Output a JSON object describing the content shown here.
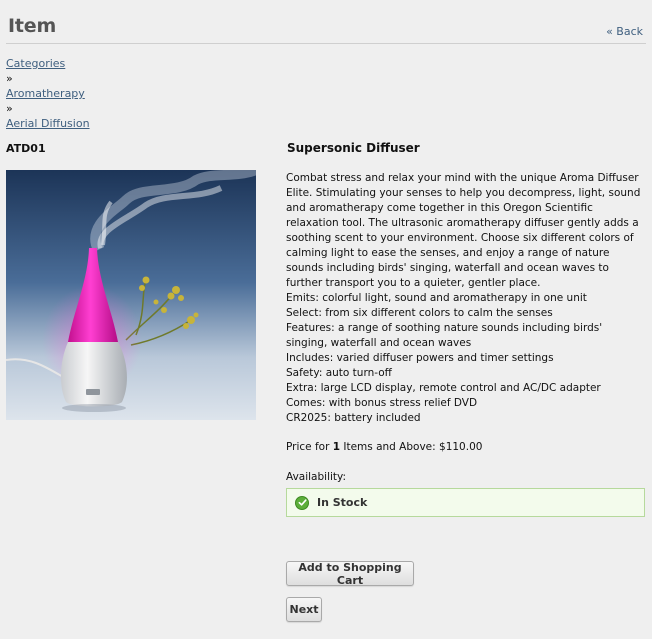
{
  "header": {
    "title": "Item",
    "back_label": "« Back"
  },
  "breadcrumb": {
    "items": [
      "Categories",
      "Aromatherapy",
      "Aerial Diffusion"
    ],
    "separator": "»"
  },
  "product": {
    "sku": "ATD01",
    "name": "Supersonic Diffuser",
    "image": "aroma-diffuser-photo",
    "description": [
      "Combat stress and relax your mind with the unique Aroma Diffuser Elite. Stimulating your senses to help you decompress, light, sound and aromatherapy come together in this Oregon Scientific relaxation tool. The ultrasonic aromatherapy diffuser gently adds a soothing scent to your environment. Choose six different colors of calming light to ease the senses, and enjoy a range of nature sounds including birds' singing, waterfall and ocean waves to further transport you to a quieter, gentler place.",
      "Emits: colorful light, sound and aromatherapy in one unit",
      "Select: from six different colors to calm the senses",
      "Features: a range of soothing nature sounds including birds' singing, waterfall and ocean waves",
      "Includes: varied diffuser powers and timer settings",
      "Safety: auto turn-off",
      "Extra: large LCD display, remote control and AC/DC adapter",
      "Comes: with bonus stress relief DVD",
      "CR2025: battery included"
    ],
    "price": {
      "prefix": "Price for ",
      "qty": "1",
      "suffix": " Items and Above: $110.00"
    },
    "availability_label": "Availability:",
    "stock_status": "In Stock"
  },
  "actions": {
    "add_to_cart": "Add to Shopping Cart",
    "next": "Next"
  },
  "colors": {
    "background": "#efefef",
    "link": "#3f5f7f",
    "stock_bg": "#f3fbec",
    "stock_border": "#b6d99c",
    "check": "#5cae3a"
  }
}
